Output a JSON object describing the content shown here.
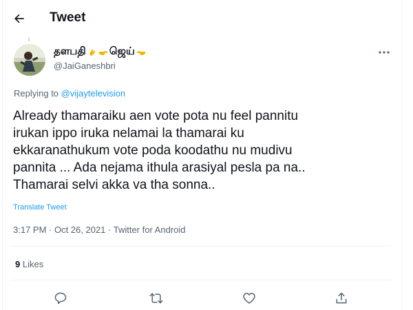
{
  "header": {
    "title": "Tweet",
    "back_icon": "arrow-left-icon"
  },
  "author": {
    "name": "தளபதி",
    "name_suffix": "ஜெய்",
    "handle": "@JaiGaneshbri",
    "emojis": [
      "clapping-hand-icon",
      "pointing-right-hand-icon",
      "pointing-left-hand-icon"
    ]
  },
  "replying": {
    "prefix": "Replying to",
    "handle": "@vijaytelevision"
  },
  "tweet": {
    "lines": [
      "Already thamaraiku aen vote pota nu feel pannitu",
      "irukan ippo iruka nelamai la thamarai ku",
      "ekkaranathukum vote poda koodathu nu mudivu",
      "pannita ... Ada nejama ithula arasiyal pesla pa na..",
      "Thamarai selvi akka va tha sonna.."
    ],
    "translate_label": "Translate Tweet",
    "meta": "3:17 PM · Oct 26, 2021 · Twitter for Android"
  },
  "stats": {
    "likes_count": "9",
    "likes_label": "Likes"
  },
  "actions": {
    "reply_icon": "reply-icon",
    "retweet_icon": "retweet-icon",
    "like_icon": "heart-icon",
    "share_icon": "share-icon"
  },
  "colors": {
    "accent": "#1d9bf0",
    "text": "#0f1419",
    "muted": "#536471",
    "border": "#eff3f4"
  }
}
